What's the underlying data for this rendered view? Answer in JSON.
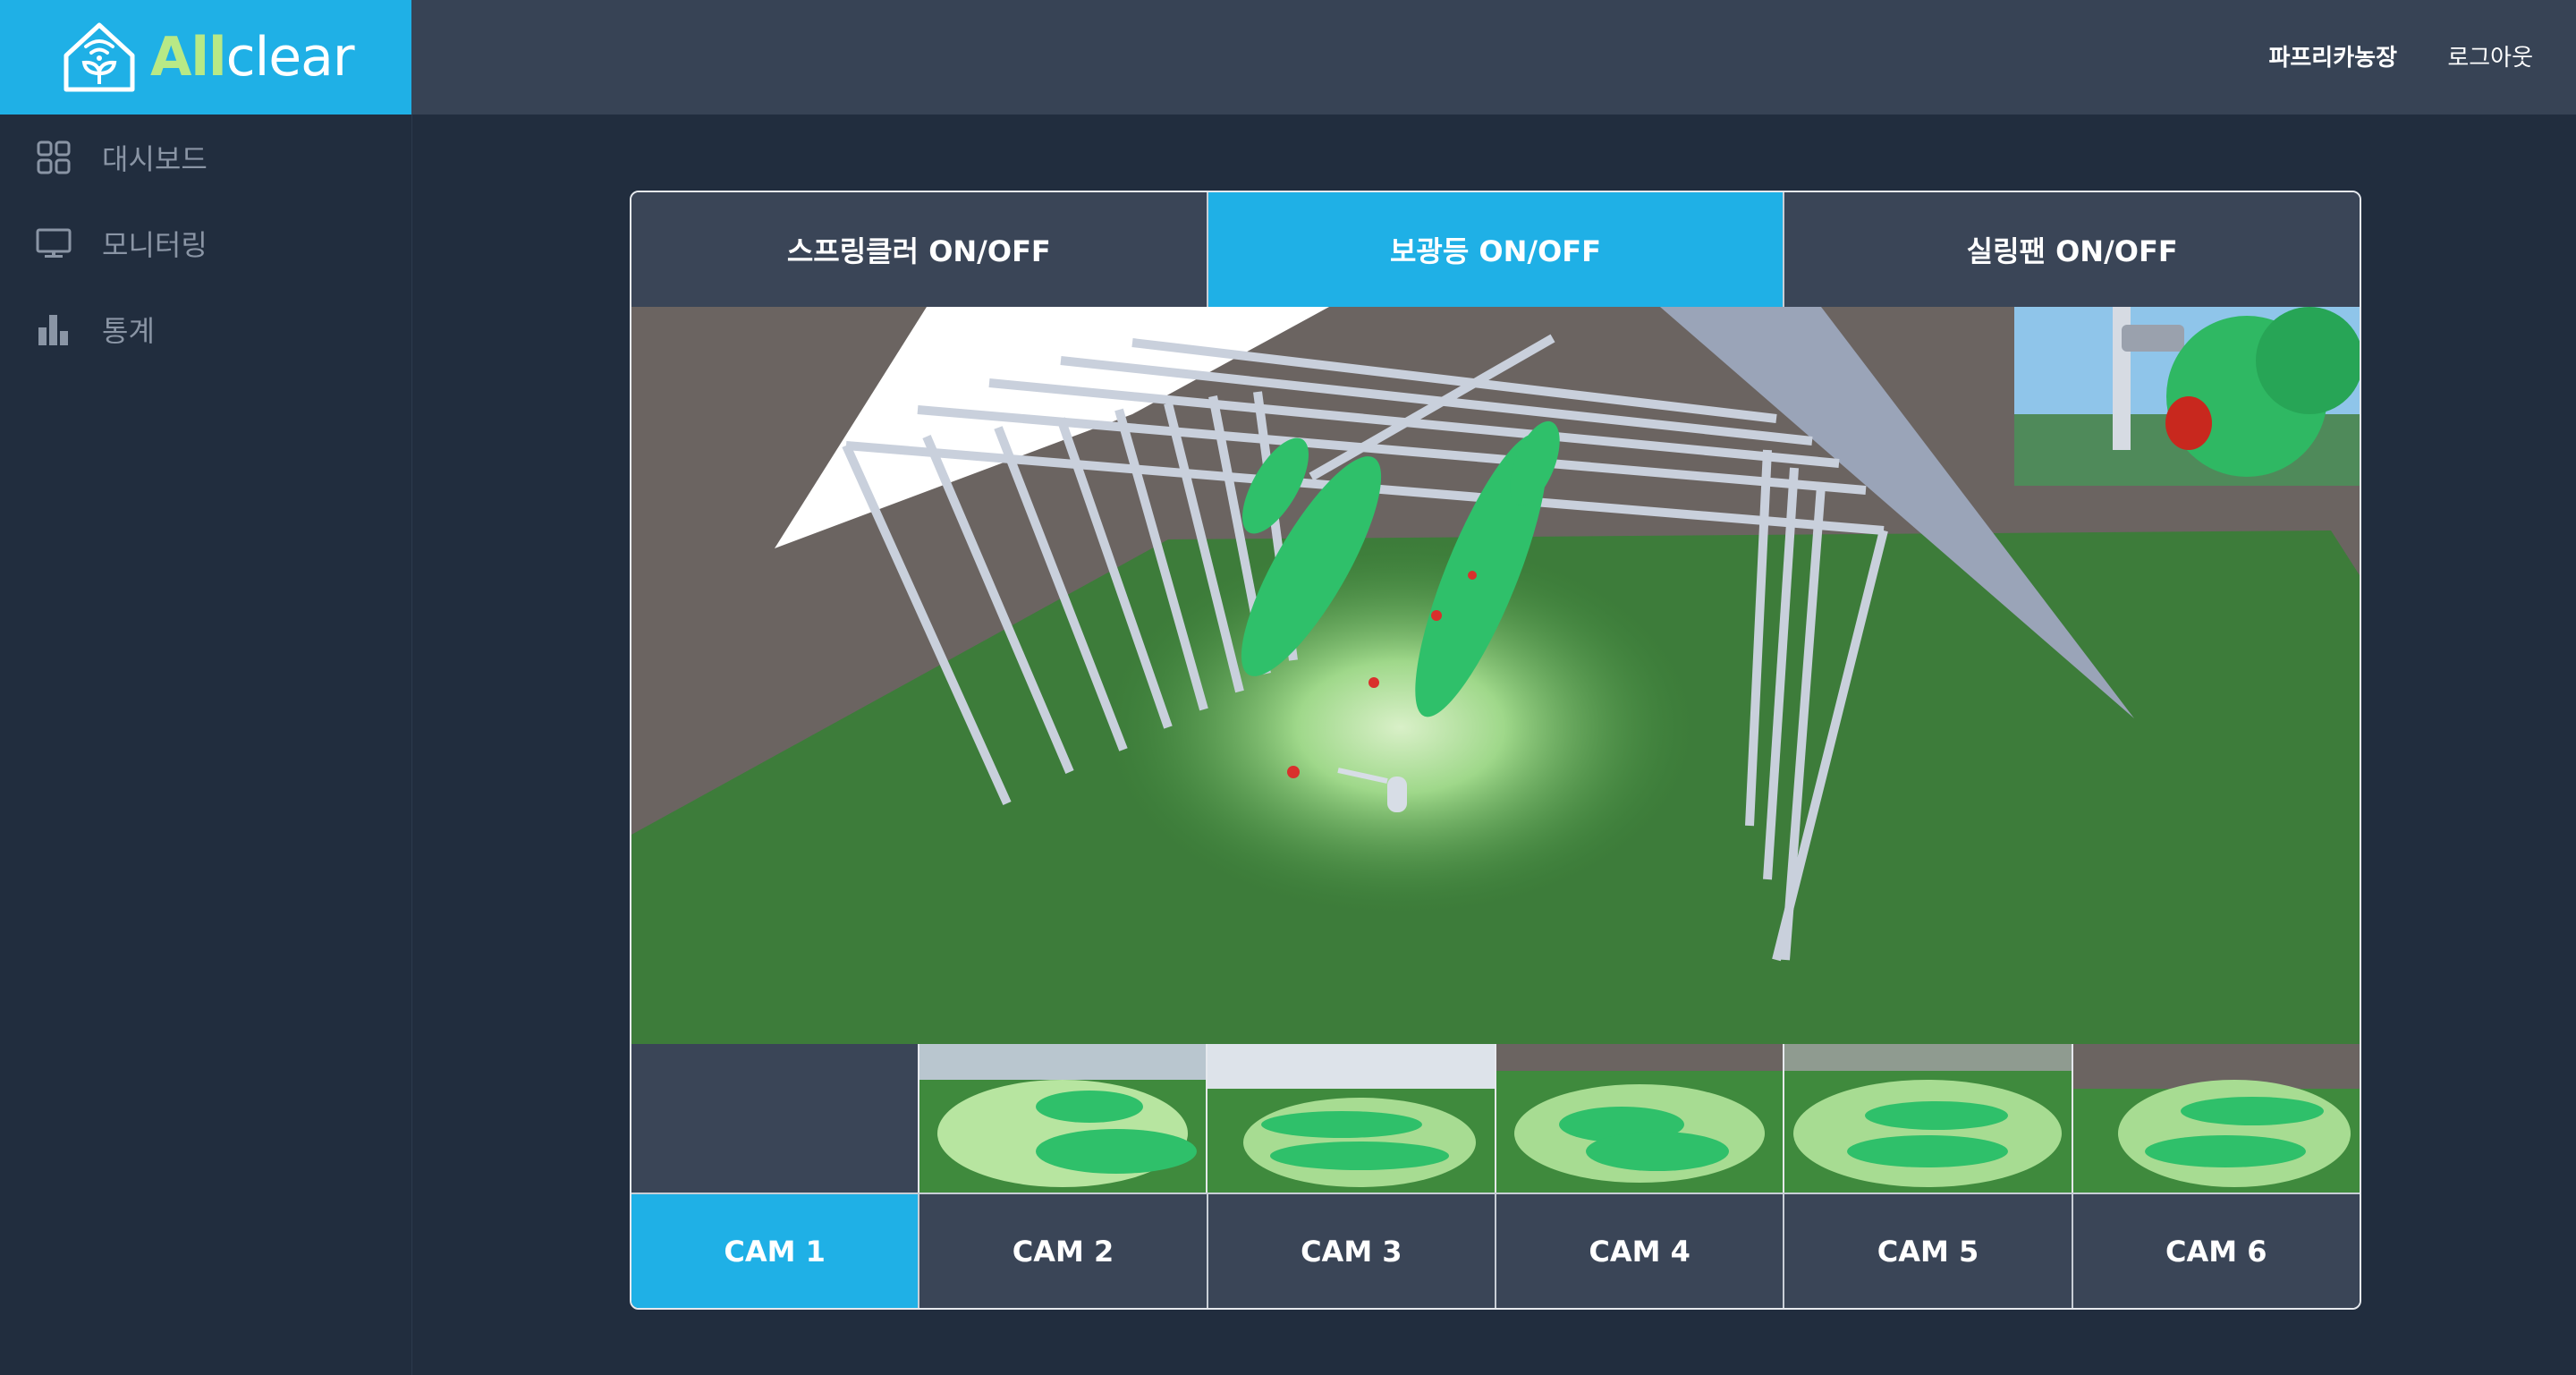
{
  "brand": {
    "name_prefix": "All",
    "name_suffix": "clear",
    "color": "#1fb0e6",
    "accent": "#b8e986"
  },
  "header": {
    "farm_name": "파프리카농장",
    "logout_label": "로그아웃"
  },
  "sidebar": {
    "items": [
      {
        "label": "대시보드",
        "icon": "grid-icon"
      },
      {
        "label": "모니터링",
        "icon": "monitor-icon"
      },
      {
        "label": "통계",
        "icon": "bar-chart-icon"
      }
    ]
  },
  "controls": {
    "tabs": [
      {
        "label": "스프링클러 ON/OFF",
        "active": false
      },
      {
        "label": "보광등 ON/OFF",
        "active": true
      },
      {
        "label": "실링팬 ON/OFF",
        "active": false
      }
    ]
  },
  "cameras": {
    "buttons": [
      {
        "label": "CAM 1",
        "active": true
      },
      {
        "label": "CAM 2",
        "active": false
      },
      {
        "label": "CAM 3",
        "active": false
      },
      {
        "label": "CAM 4",
        "active": false
      },
      {
        "label": "CAM 5",
        "active": false
      },
      {
        "label": "CAM 6",
        "active": false
      }
    ]
  }
}
